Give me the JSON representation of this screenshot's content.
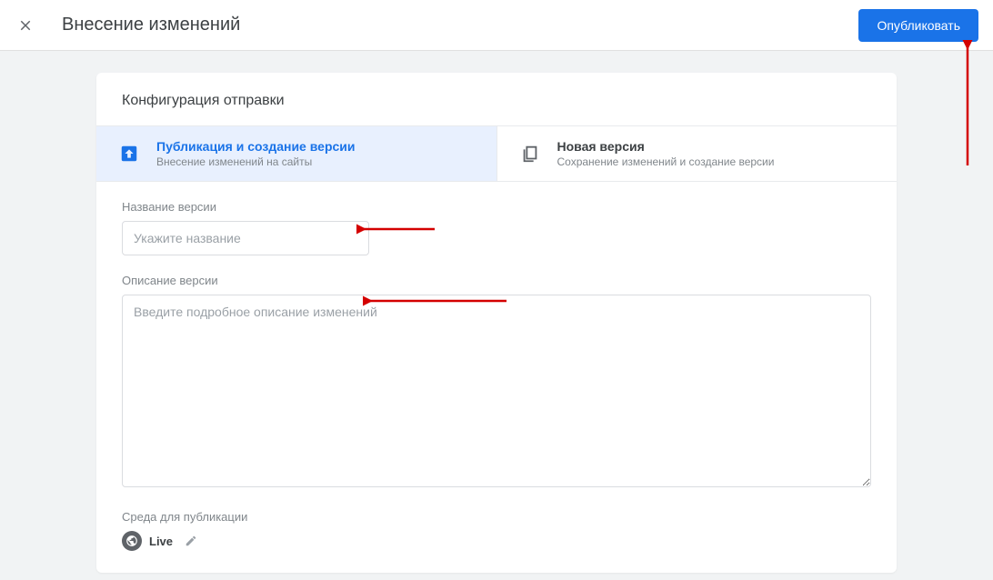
{
  "header": {
    "title": "Внесение изменений",
    "publish_button": "Опубликовать"
  },
  "card": {
    "title": "Конфигурация отправки",
    "tabs": [
      {
        "title": "Публикация и создание версии",
        "subtitle": "Внесение изменений на сайты",
        "active": true
      },
      {
        "title": "Новая версия",
        "subtitle": "Сохранение изменений и создание версии",
        "active": false
      }
    ],
    "version_name": {
      "label": "Название версии",
      "placeholder": "Укажите название",
      "value": ""
    },
    "version_desc": {
      "label": "Описание версии",
      "placeholder": "Введите подробное описание изменений",
      "value": ""
    },
    "environment": {
      "label": "Среда для публикации",
      "name": "Live"
    }
  }
}
